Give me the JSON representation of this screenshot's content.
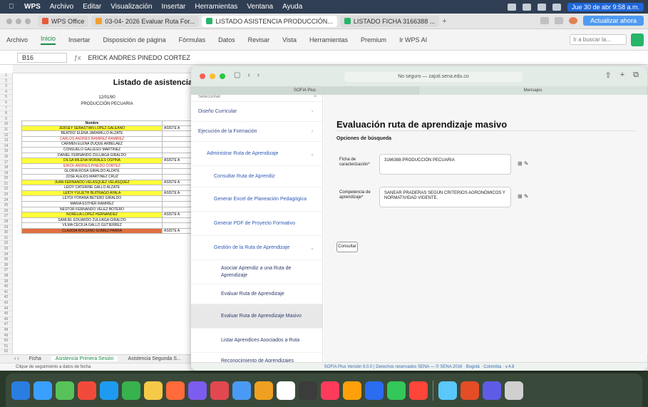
{
  "menubar": {
    "items": [
      "WPS",
      "Archivo",
      "Editar",
      "Visualización",
      "Insertar",
      "Herramientas",
      "Ventana",
      "Ayuda"
    ],
    "clock": "Jue 30 de abr 9:58 a.m."
  },
  "browser_tabs_top": [
    {
      "label": "WPS Office",
      "color": "#e85a3a"
    },
    {
      "label": "03-04- 2026 Evaluar Ruta For...",
      "color": "#f0a030"
    },
    {
      "label": "LISTADO ASISTENCIA PRODUCCIÓN...",
      "color": "#26b56a"
    },
    {
      "label": "LISTADO FICHA 3166388 ...",
      "color": "#26b56a"
    }
  ],
  "topright_badge": "Actualizar ahora",
  "ribbon": {
    "tabs": [
      "Archivo",
      "Inicio",
      "Insertar",
      "Disposición de página",
      "Fórmulas",
      "Datos",
      "Revisar",
      "Vista",
      "Herramientas",
      "Premium",
      "Ir WPS AI"
    ],
    "selected": "Inicio",
    "search_placeholder": "Ir a buscar la..."
  },
  "formula": {
    "cellref": "B16",
    "content": "ERICK ANDRES PINEDO CORTEZ"
  },
  "sheet": {
    "title": "Listado de asistencia",
    "subtitles": [
      "12/01/80",
      "PRODUCCIÓN PECUARIA"
    ],
    "header": "Nombre",
    "assist_label": "ASISTE A",
    "rows": [
      {
        "name": "JERSEY SEBASTIAN LOPEZ GALEANO",
        "bg": "#ffff3a",
        "color": "#111",
        "assist": true
      },
      {
        "name": "BEATRIZ ELENA JARAMILLO ALZATE",
        "bg": "#ffffff",
        "color": "#111",
        "assist": false
      },
      {
        "name": "CARLOS ANDRES RAMIREZ RAMIREZ",
        "bg": "#ffffff",
        "color": "#d02020",
        "assist": false
      },
      {
        "name": "CARMEN ELENA DUQUE ARBELAEZ",
        "bg": "#ffffff",
        "color": "#111",
        "assist": false
      },
      {
        "name": "CONSUELO GALLEGO MARTINEZ",
        "bg": "#ffffff",
        "color": "#111",
        "assist": false
      },
      {
        "name": "DANIEL FERNANDO ZULUAGA GIRALDO",
        "bg": "#ffffff",
        "color": "#111",
        "assist": false
      },
      {
        "name": "DILSA MILENA MORALES OSPINA",
        "bg": "#ffff3a",
        "color": "#111",
        "assist": true
      },
      {
        "name": "ERICK ANDRES PINEDO CORTEZ",
        "bg": "#ffffff",
        "color": "#d02020",
        "assist": false
      },
      {
        "name": "GLORIA ROSA GIRALDO ALZATE",
        "bg": "#ffffff",
        "color": "#111",
        "assist": false
      },
      {
        "name": "JOSE ALEXIS MARTINEZ CRUZ",
        "bg": "#ffffff",
        "color": "#111",
        "assist": false
      },
      {
        "name": "JUAN FERNANDO VELASQUEZ VELASQUEZ",
        "bg": "#ffff3a",
        "color": "#111",
        "assist": true
      },
      {
        "name": "LEIDY CATERINE GALLO ALZATE",
        "bg": "#ffffff",
        "color": "#111",
        "assist": false
      },
      {
        "name": "LEIDY YULIETH BUITRAGO AYALA",
        "bg": "#ffff3a",
        "color": "#111",
        "assist": true
      },
      {
        "name": "LEYDI YOHANA BETERO GIRALDO",
        "bg": "#ffffff",
        "color": "#111",
        "assist": false
      },
      {
        "name": "MARIA ESTHER RAMIREZ",
        "bg": "#ffffff",
        "color": "#111",
        "assist": false
      },
      {
        "name": "NESTOR FERNANDO VELEZ BOTERO",
        "bg": "#ffffff",
        "color": "#111",
        "assist": false
      },
      {
        "name": "NORELIA LOPEZ HERNANDEZ",
        "bg": "#ffff3a",
        "color": "#111",
        "assist": true
      },
      {
        "name": "SAMUEL EDUARDO ZULUAGA GIRALDO",
        "bg": "#ffffff",
        "color": "#111",
        "assist": false
      },
      {
        "name": "VILMA CECILIA GALLO GUTIERREZ",
        "bg": "#ffffff",
        "color": "#111",
        "assist": false
      },
      {
        "name": "CLAUDIA ROCIANO GOMEZ PARRA",
        "bg": "#e07040",
        "color": "#111",
        "assist": true
      }
    ],
    "sheet_tabs": [
      "Ficha",
      "Asistencia Primera Sesión",
      "Asistencia Segunda S..."
    ],
    "status": "Clique de seguimiento a datos de fecha"
  },
  "browser": {
    "url": "No seguro — zajuti.sena.edu.co",
    "tabs": [
      "SOFIA Plus",
      "Mensajes"
    ],
    "sidebar_top": "Seleccionar",
    "side_items": [
      {
        "label": "Diseño Curricular",
        "level": 0,
        "chev": "›"
      },
      {
        "label": "Ejecución de la Formación",
        "level": 0,
        "chev": "›"
      },
      {
        "label": "Administrar Ruta de Aprendizaje",
        "level": 1,
        "chev": "⌄"
      },
      {
        "label": "Consultar Ruta de Aprendiz",
        "level": 2,
        "chev": ""
      },
      {
        "label": "Generar Excel de Planeación Pedagógica",
        "level": 2,
        "chev": ""
      },
      {
        "label": "Generar PDF de Proyecto Formativo",
        "level": 2,
        "chev": ""
      },
      {
        "label": "Gestión de la Ruta de Aprendizaje",
        "level": 2,
        "chev": "⌄"
      },
      {
        "label": "Asociar Aprendiz a una Ruta de Aprendizaje",
        "level": 3,
        "chev": ""
      },
      {
        "label": "Evaluar Ruta de Aprendizaje",
        "level": 3,
        "chev": ""
      },
      {
        "label": "Evaluar Ruta de Aprendizaje Masivo",
        "level": 3,
        "chev": "",
        "active": true
      },
      {
        "label": "Listar Aprendices Asociados a Ruta",
        "level": 3,
        "chev": ""
      },
      {
        "label": "Reconocimiento de Aprendizajes Previos Masivo",
        "level": 3,
        "chev": ""
      },
      {
        "label": "Reconocimiento de Aprendizajes",
        "level": 3,
        "chev": ""
      }
    ],
    "main_title": "Evaluación ruta de aprendizaje masivo",
    "section": "Opciones de búsqueda",
    "fields": [
      {
        "label": "Ficha de caracterización*",
        "value": "3166388-PRODUCCIÓN PECUARIA"
      },
      {
        "label": "Competencia de aprendizaje*",
        "value": "SANEAR PRADERAS SEGÚN CRITERIOS AGRONÓMICOS Y NORMATIVIDAD VIGENTE."
      }
    ],
    "consultar": "Consultar",
    "footer": "SOFIA Plus Versión 9.0.0 | Derechos reservados SENA — © SENA 2016 · Bogotá · Colombia · v.4.8"
  },
  "dock_colors": [
    "#2a7de1",
    "#3aa0ff",
    "#58c25a",
    "#f24a3a",
    "#1e9bf0",
    "#37b24d",
    "#f7c948",
    "#ff6b3b",
    "#7d5cf0",
    "#e34850",
    "#4a9af5",
    "#f0a020",
    "#ffffff",
    "#3c3c3c",
    "#ff3b5c",
    "#ff9f0a",
    "#2b6cf0",
    "#34c759",
    "#ff453a",
    "#5ac8fa",
    "#e44d26",
    "#5e5ce6",
    "#d0d0d0"
  ]
}
